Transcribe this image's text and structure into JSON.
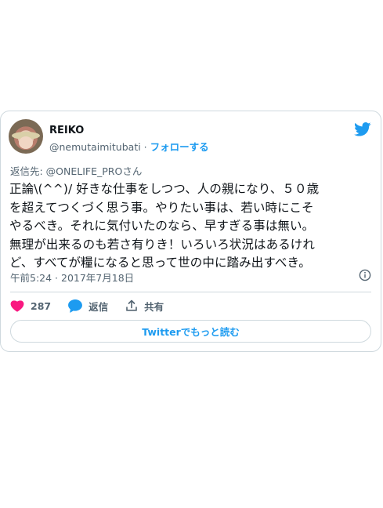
{
  "tweet": {
    "display_name": "REIKO",
    "handle": "@nemutaimitubati",
    "separator": " · ",
    "follow_label": "フォローする",
    "reply_to": "返信先: @ONELIFE_PROさん",
    "text": "正論\\(^^)/  好きな仕事をしつつ、人の親になり、５０歳\nを超えてつくづく思う事。やりたい事は、若い時にこそ\nやるべき。それに気付いたのなら、早すぎる事は無い。\n無理が出来るのも若さ有りき！いろいろ状況はあるけれ\nど、すべてが糧になると思って世の中に踏み出すべき。",
    "timestamp": "午前5:24 · 2017年7月18日",
    "like_count": "287",
    "reply_label": "返信",
    "share_label": "共有",
    "read_more_label": "Twitterでもっと読む"
  },
  "colors": {
    "accent": "#1d9bf0",
    "like": "#f91880",
    "muted_text": "#536471",
    "border": "#cfd9de"
  },
  "icons": [
    "twitter-bird-icon",
    "info-icon",
    "heart-icon",
    "reply-bubble-icon",
    "share-icon"
  ]
}
